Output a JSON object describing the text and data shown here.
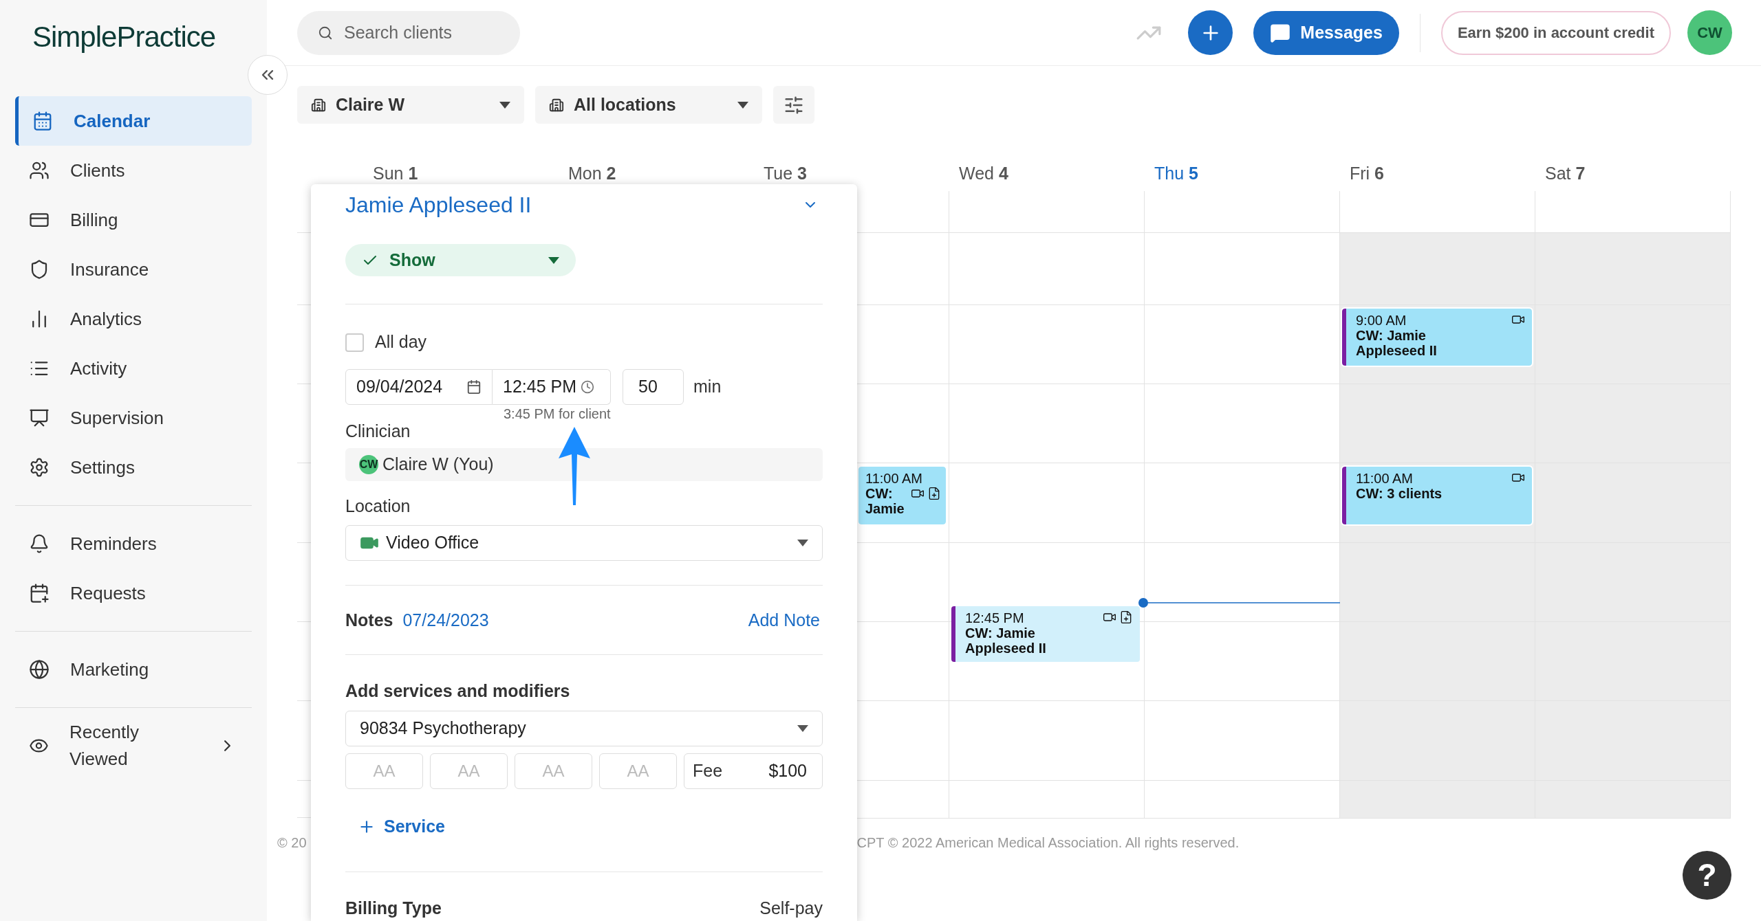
{
  "sidebar": {
    "logo": "SimplePractice",
    "sections": [
      {
        "items": [
          {
            "label": "Calendar",
            "selected": true,
            "kind": "link"
          },
          {
            "label": "Clients",
            "selected": false,
            "kind": "link"
          },
          {
            "label": "Billing",
            "selected": false,
            "kind": "link"
          },
          {
            "label": "Insurance",
            "selected": false,
            "kind": "link"
          },
          {
            "label": "Analytics",
            "selected": false,
            "kind": "link"
          },
          {
            "label": "Activity",
            "selected": false,
            "kind": "link"
          },
          {
            "label": "Supervision",
            "selected": false,
            "kind": "link"
          },
          {
            "label": "Settings",
            "selected": false,
            "kind": "link"
          }
        ]
      },
      {
        "items": [
          {
            "label": "Reminders",
            "selected": false,
            "kind": "link"
          },
          {
            "label": "Requests",
            "selected": false,
            "kind": "link"
          }
        ]
      },
      {
        "items": [
          {
            "label": "Marketing",
            "selected": false,
            "kind": "link"
          }
        ]
      },
      {
        "items": [
          {
            "label": "Recently Viewed",
            "selected": false,
            "kind": "submenu"
          }
        ]
      }
    ]
  },
  "header": {
    "search": {
      "placeholder": "Search clients"
    },
    "messages_button": "Messages",
    "credit_button": "Earn $200 in account credit",
    "avatar": "CW"
  },
  "filters": [
    "Claire W",
    "All locations"
  ],
  "calendar": {
    "days": [
      {
        "name": "Sun",
        "number": "1",
        "today": false,
        "unavailable": false
      },
      {
        "name": "Mon",
        "number": "2",
        "today": false,
        "unavailable": false
      },
      {
        "name": "Tue",
        "number": "3",
        "today": false,
        "unavailable": false
      },
      {
        "name": "Wed",
        "number": "4",
        "today": false,
        "unavailable": false
      },
      {
        "name": "Thu",
        "number": "5",
        "today": true,
        "unavailable": false
      },
      {
        "name": "Fri",
        "number": "6",
        "today": false,
        "unavailable": true
      },
      {
        "name": "Sat",
        "number": "7",
        "today": false,
        "unavailable": true
      }
    ],
    "events": [
      {
        "time": "11:00 AM",
        "title": "CW: Jamie",
        "selected": false,
        "video": true,
        "note_action": true
      },
      {
        "time": "12:45 PM",
        "title": "CW: Jamie Appleseed II",
        "selected": true,
        "video": true,
        "note_action": true
      },
      {
        "time": "9:00 AM",
        "title": "CW: Jamie Appleseed II",
        "selected": false,
        "video": true,
        "note_action": false
      },
      {
        "time": "11:00 AM",
        "title": "CW: 3 clients",
        "selected": false,
        "video": true,
        "note_action": false
      }
    ]
  },
  "appointment": {
    "client": "Jamie Appleseed II",
    "status": "Show",
    "all_day": {
      "label": "All day",
      "checked": false
    },
    "date": "09/04/2024",
    "time": "12:45 PM",
    "duration": "50",
    "duration_unit": "min",
    "client_time": "3:45 PM for client",
    "clinician": {
      "label": "Clinician",
      "initials": "CW",
      "value": "Claire W (You)"
    },
    "location": {
      "label": "Location",
      "value": "Video Office"
    },
    "notes": {
      "label": "Notes",
      "date": "07/24/2023",
      "add": "Add Note"
    },
    "services": {
      "title": "Add services and modifiers",
      "service": "90834 Psychotherapy",
      "modifier_placeholders": [
        "AA",
        "AA",
        "AA",
        "AA"
      ],
      "fee_label": "Fee",
      "fee": "$100",
      "add_button": "Service"
    },
    "billing": {
      "label": "Billing Type",
      "value": "Self-pay"
    }
  },
  "footer": [
    "© 20",
    "CPT © 2022 American Medical Association. All rights reserved."
  ],
  "help_button": "?"
}
